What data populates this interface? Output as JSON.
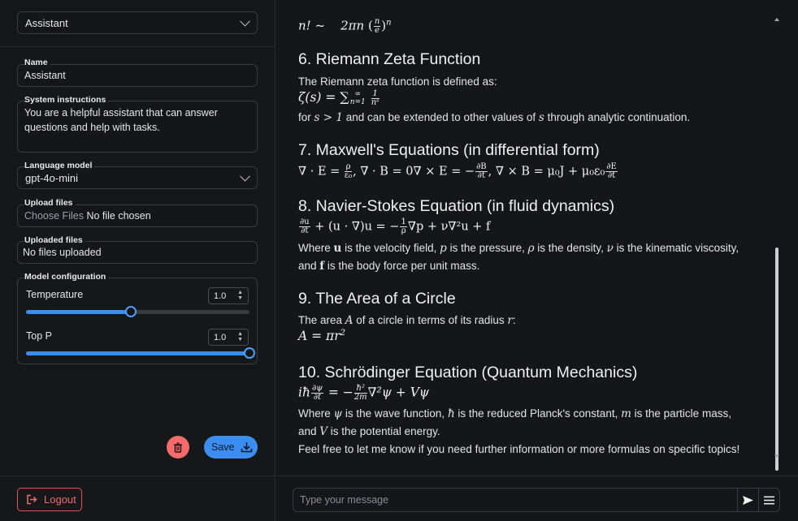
{
  "sidebar": {
    "assistant_select": "Assistant",
    "name": {
      "label": "Name",
      "value": "Assistant"
    },
    "system_instructions": {
      "label": "System instructions",
      "line1": "You are a helpful assistant that can answer",
      "line2": "questions and help with tasks."
    },
    "language_model": {
      "label": "Language model",
      "value": "gpt-4o-mini"
    },
    "upload_files": {
      "label": "Upload files",
      "button": "Choose Files",
      "status": "No file chosen"
    },
    "uploaded_files": {
      "label": "Uploaded files",
      "value": "No files uploaded"
    },
    "model_configuration": {
      "label": "Model configuration",
      "temperature": {
        "label": "Temperature",
        "value": "1.0",
        "slider_fraction": 0.47
      },
      "top_p": {
        "label": "Top P",
        "value": "1.0",
        "slider_fraction": 1.0
      }
    },
    "save_label": "Save",
    "logout_label": "Logout"
  },
  "chat": {
    "stirling": {
      "lhs": "n! ~",
      "mid": "2πn",
      "num": "n",
      "den": "e",
      "exp": "n"
    },
    "section6": {
      "title": "6. Riemann Zeta Function",
      "intro": "The Riemann zeta function is defined as:",
      "formula": {
        "lhs": "ζ(s) = ",
        "sum_top": "∞",
        "sum_bottom": "n=1",
        "num": "1",
        "den": "nˢ"
      },
      "line": {
        "pre": "for ",
        "cond": "s > 1",
        "mid": " and can be extended to other values of ",
        "var": "s",
        "post": " through analytic continuation."
      }
    },
    "section7": {
      "title": "7. Maxwell's Equations (in differential form)",
      "eq1": "∇ · E = ",
      "eq1_num": "ρ",
      "eq1_den": "ε₀",
      "eq2": ",   ∇ · B = 0∇ × E = −",
      "eq2_num": "∂B",
      "eq2_den": "∂t",
      "eq3": ",   ∇ × B = μ₀J + μ₀ε₀",
      "eq3_num": "∂E",
      "eq3_den": "∂t"
    },
    "section8": {
      "title": "8. Navier-Stokes Equation (in fluid dynamics)",
      "num1": "∂u",
      "den1": "∂t",
      "mid": " + (u · ∇)u = −",
      "num2": "1",
      "den2": "ρ",
      "rest": "∇p + ν∇²u + f",
      "line1": {
        "a": "Where ",
        "u": "u",
        "b": " is the velocity field, ",
        "p": "p",
        "c": " is the pressure, ",
        "rho": "ρ",
        "d": " is the density, ",
        "nu": "ν",
        "e": " is the kinematic viscosity,"
      },
      "line2": {
        "a": "and ",
        "f": "f",
        "b": " is the body force per unit mass."
      }
    },
    "section9": {
      "title": "9. The Area of a Circle",
      "line": {
        "a": "The area ",
        "A": "A",
        "b": " of a circle in terms of its radius ",
        "r": "r",
        "c": ":"
      },
      "formula": "A = πr",
      "exp": "2"
    },
    "section10": {
      "title": "10. Schrödinger Equation (Quantum Mechanics)",
      "lhs": "iħ",
      "num1": "∂ψ",
      "den1": "∂t",
      "mid": " = −",
      "num2": "ħ²",
      "den2": "2m",
      "rest": "∇²ψ + Vψ",
      "line1": {
        "a": "Where ",
        "psi": "ψ",
        "b": " is the wave function, ",
        "hbar": "ħ",
        "c": " is the reduced Planck's constant, ",
        "m": "m",
        "d": " is the particle mass,"
      },
      "line2": {
        "a": "and ",
        "V": "V",
        "b": " is the potential energy."
      },
      "closing": "Feel free to let me know if you need further information or more formulas on specific topics!"
    },
    "input_placeholder": "Type your message"
  },
  "icons": {
    "send": "send-icon",
    "menu": "menu-icon",
    "trash": "trash-icon",
    "download": "download-icon",
    "logout": "logout-icon"
  },
  "colors": {
    "accent": "#3b8ef0",
    "danger": "#f36b6b",
    "background": "#151619"
  }
}
